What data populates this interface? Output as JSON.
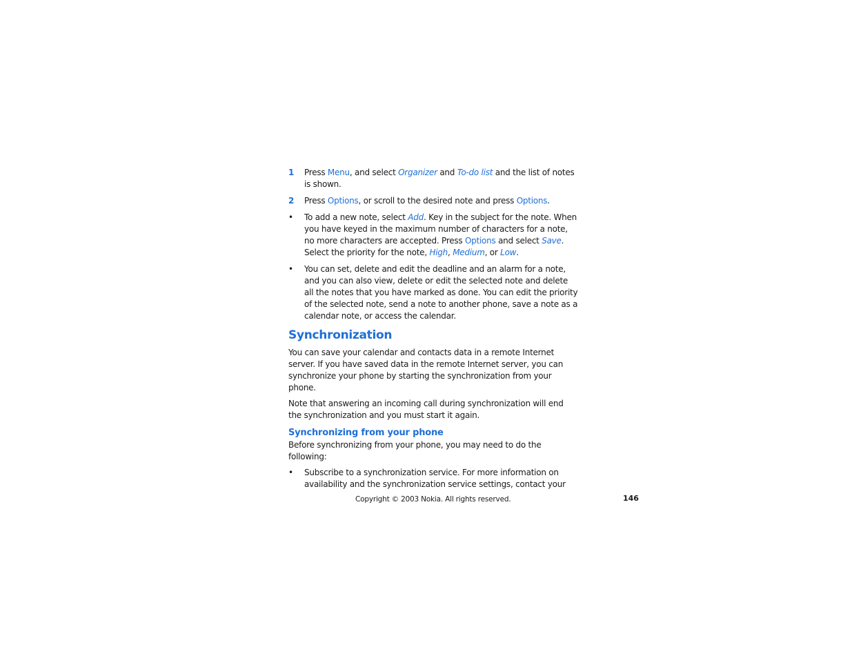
{
  "steps": [
    {
      "marker": "1",
      "segments": [
        {
          "t": "Press ",
          "s": "plain"
        },
        {
          "t": "Menu",
          "s": "hl"
        },
        {
          "t": ", and select ",
          "s": "plain"
        },
        {
          "t": "Organizer",
          "s": "it"
        },
        {
          "t": " and ",
          "s": "plain"
        },
        {
          "t": "To-do list",
          "s": "it"
        },
        {
          "t": " and the list of notes is shown.",
          "s": "plain"
        }
      ]
    },
    {
      "marker": "2",
      "segments": [
        {
          "t": "Press ",
          "s": "plain"
        },
        {
          "t": "Options",
          "s": "hl"
        },
        {
          "t": ", or scroll to the desired note and press ",
          "s": "plain"
        },
        {
          "t": "Options",
          "s": "hl"
        },
        {
          "t": ".",
          "s": "plain"
        }
      ]
    }
  ],
  "bullets_top": [
    {
      "marker": "•",
      "segments": [
        {
          "t": "To add a new note, select ",
          "s": "plain"
        },
        {
          "t": "Add",
          "s": "it"
        },
        {
          "t": ". Key in the subject for the note. When you have keyed in the maximum number of characters for a note, no more characters are accepted. Press ",
          "s": "plain"
        },
        {
          "t": "Options",
          "s": "hl"
        },
        {
          "t": " and select ",
          "s": "plain"
        },
        {
          "t": "Save",
          "s": "it"
        },
        {
          "t": ". Select the priority for the note, ",
          "s": "plain"
        },
        {
          "t": "High",
          "s": "it"
        },
        {
          "t": ", ",
          "s": "plain"
        },
        {
          "t": "Medium",
          "s": "it"
        },
        {
          "t": ", or ",
          "s": "plain"
        },
        {
          "t": "Low",
          "s": "it"
        },
        {
          "t": ".",
          "s": "plain"
        }
      ]
    },
    {
      "marker": "•",
      "segments": [
        {
          "t": "You can set, delete and edit the deadline and an alarm for a note, and you can also view, delete or edit the selected note and delete all the notes that you have marked as done. You can edit the priority of the selected note, send a note to another phone, save a note as a calendar note, or access the calendar.",
          "s": "plain"
        }
      ]
    }
  ],
  "section": {
    "heading": "Synchronization",
    "paragraphs": [
      "You can save your calendar and contacts data in a remote Internet server. If you have saved data in the remote Internet server, you can synchronize your phone by starting the synchronization from your phone.",
      "Note that answering an incoming call during synchronization will end the synchronization and you must start it again."
    ],
    "subheading": "Synchronizing from your phone",
    "intro": "Before synchronizing from your phone, you may need to do the following:",
    "bullets": [
      {
        "marker": "•",
        "text": "Subscribe to a synchronization service. For more information on availability and the synchronization service settings, contact your"
      }
    ]
  },
  "footer": {
    "copyright": "Copyright © 2003 Nokia. All rights reserved.",
    "page_number": "146"
  }
}
